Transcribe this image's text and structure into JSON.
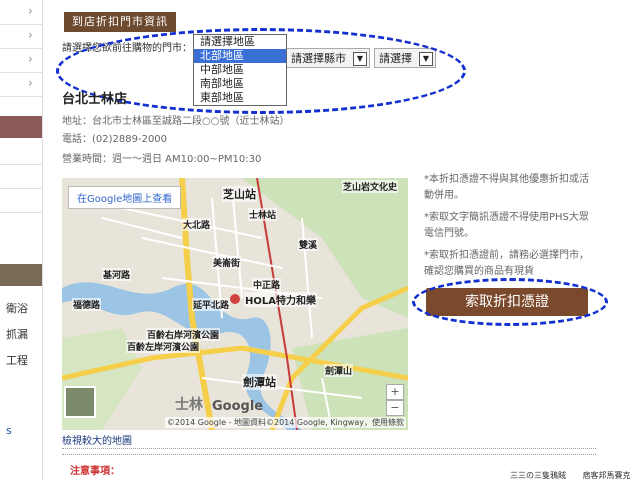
{
  "sidebar": {
    "items": [
      "衛浴",
      "抓漏",
      "工程"
    ],
    "link_fragment": "s"
  },
  "section_title": "到店折扣門市資訊",
  "selector": {
    "prompt": "請選擇您欲前往購物的門市：",
    "region_options": [
      "請選擇地區",
      "北部地區",
      "中部地區",
      "南部地區",
      "東部地區"
    ],
    "selected_region": "北部地區",
    "county_select": "請選擇縣市",
    "store_select": "請選擇"
  },
  "store": {
    "name": "台北士林店",
    "address": "地址：台北市士林區至誠路二段○○號（近士林站）",
    "phone": "電話：(02)2889-2000",
    "hours": "營業時間：週一～週日 AM10:00~PM10:30"
  },
  "map": {
    "view_larger_button": "在Google地圖上查看",
    "store_marker_label": "HOLA特力和樂",
    "labels": [
      "芝山站",
      "士林站",
      "劍潭站",
      "劍潭山",
      "百齡右岸河濱公園",
      "百齡左岸河濱公園",
      "中正路",
      "延平北路",
      "雙溪",
      "芝山岩文化史",
      "基河路",
      "大北路",
      "美崙街",
      "士林",
      "福德路"
    ],
    "road_numbers": [
      "2",
      "1",
      "2",
      "5",
      "1"
    ],
    "attribution": "©2014 Google - 地圖資料©2014 Google, Kingway，使用條款",
    "google_text": "Google",
    "zoom_in": "+",
    "zoom_out": "−",
    "view_larger_link": "檢視較大的地圖"
  },
  "notes": [
    "*本折扣憑證不得與其他優惠折扣或活動併用。",
    "*索取文字簡訊憑證不得使用PHS大眾電信門號。",
    "*索取折扣憑證前，請務必選擇門市，確認您購買的商品有現貨"
  ],
  "redeem_button": "索取折扣憑證",
  "notices_title": "注意事項：",
  "footer_fragments": [
    "三三の三隻鴉賊",
    "痞客邦馬賽克"
  ],
  "colors": {
    "brand_brown": "#6e4a2f",
    "button_brown": "#7b4a2d",
    "annotation_blue": "#1330d0",
    "dropdown_highlight": "#3a6fd6"
  }
}
